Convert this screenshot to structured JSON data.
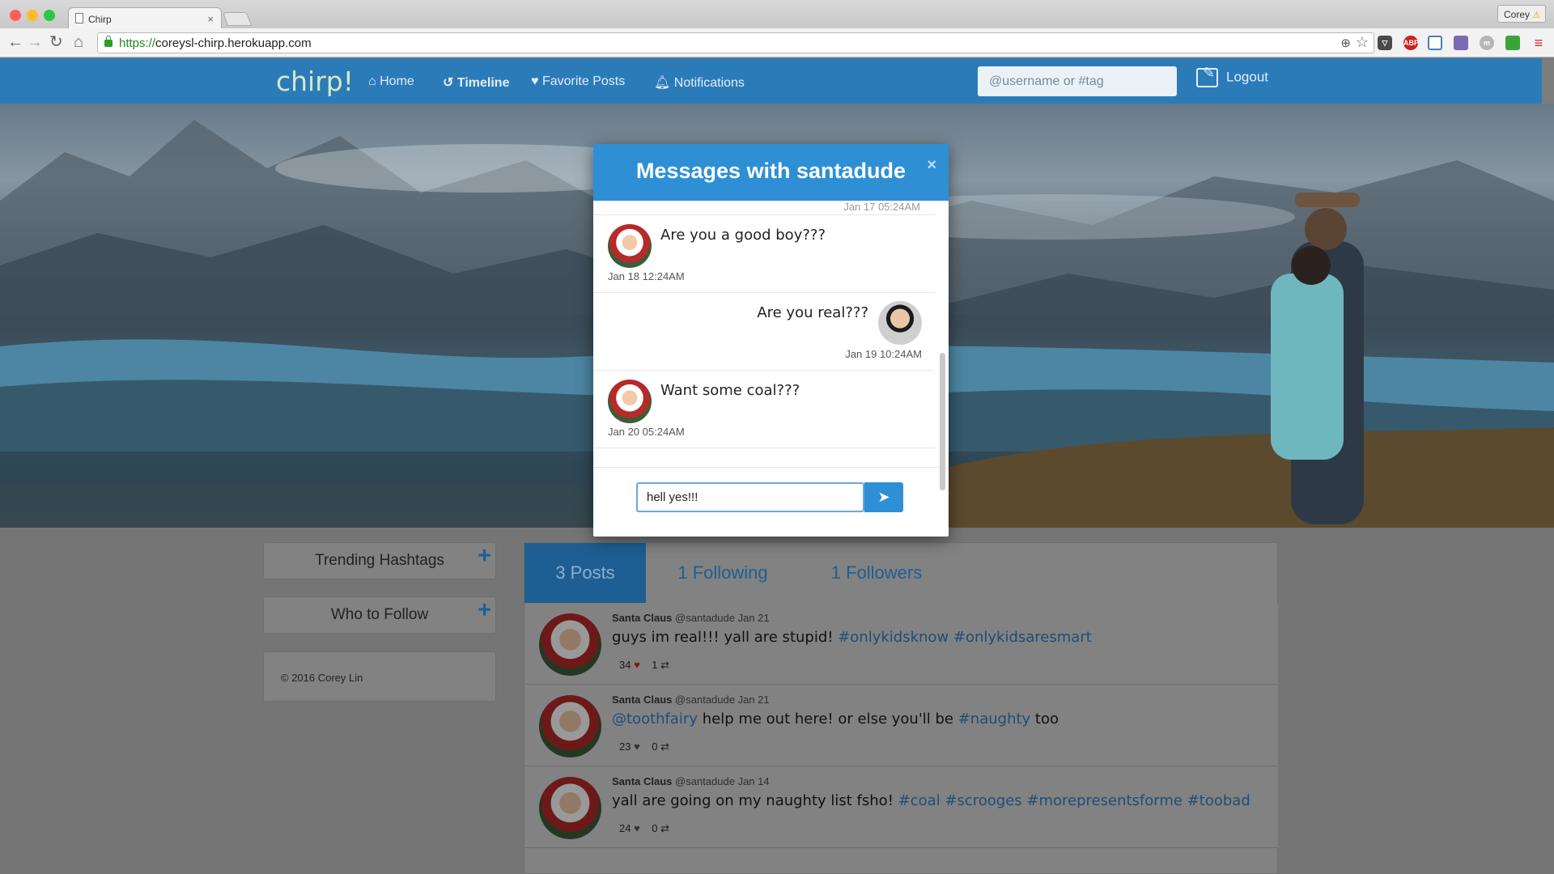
{
  "browser": {
    "tab_title": "Chirp",
    "tab_close": "×",
    "profile_name": "Corey",
    "profile_warning": "⚠",
    "url_scheme": "https://",
    "url_host": "coreysl-chirp.herokuapp.com",
    "extensions": [
      "pocket-icon",
      "adblock-icon",
      "screenshot-icon",
      "grid-icon",
      "m-icon",
      "new-icon",
      "menu-icon"
    ],
    "adblock_label": "ABP"
  },
  "app": {
    "brand": "chirp!",
    "nav": {
      "home": "Home",
      "timeline": "Timeline",
      "favorites": "Favorite Posts",
      "notifications": "Notifications"
    },
    "search_placeholder": "@username or #tag",
    "logout": "Logout",
    "nav_color": "#2b7bb9"
  },
  "modal": {
    "title": "Messages with santadude",
    "close": "×",
    "clipped_time": "Jan 17 05:24AM",
    "messages": [
      {
        "text": "Are you a good boy???",
        "time": "Jan 18 12:24AM",
        "from": "santadude"
      },
      {
        "text": "Are you real???",
        "time": "Jan 19 10:24AM",
        "from": "me"
      },
      {
        "text": "Want some coal???",
        "time": "Jan 20 05:24AM",
        "from": "santadude"
      }
    ],
    "compose_value": "hell yes!!!",
    "send_icon": "paper-plane-icon",
    "accent": "#2e8fd5"
  },
  "sidebar": {
    "trending": "Trending Hashtags",
    "who_to_follow": "Who to Follow",
    "plus": "+",
    "copyright": "© 2016 Corey Lin"
  },
  "profile": {
    "tabs": {
      "posts": "3 Posts",
      "following": "1 Following",
      "followers": "1 Followers"
    },
    "posts": [
      {
        "name": "Santa Claus",
        "handle": "@santadude",
        "date": "Jan 21",
        "text": "guys im real!!! yall are stupid! ",
        "tags": [
          "#onlykidsknow",
          "#onlykidsaresmart"
        ],
        "likes": "34",
        "rechirps": "1",
        "liked": true
      },
      {
        "name": "Santa Claus",
        "handle": "@santadude",
        "date": "Jan 21",
        "mention": "@toothfairy",
        "text": " help me out here! or else you'll be ",
        "tag": "#naughty",
        "tail": " too",
        "likes": "23",
        "rechirps": "0",
        "liked": false
      },
      {
        "name": "Santa Claus",
        "handle": "@santadude",
        "date": "Jan 14",
        "text": "yall are going on my naughty list fsho! ",
        "tags": [
          "#coal",
          "#scrooges",
          "#morepresentsforme",
          "#toobad"
        ],
        "likes": "24",
        "rechirps": "0",
        "liked": false
      }
    ]
  }
}
